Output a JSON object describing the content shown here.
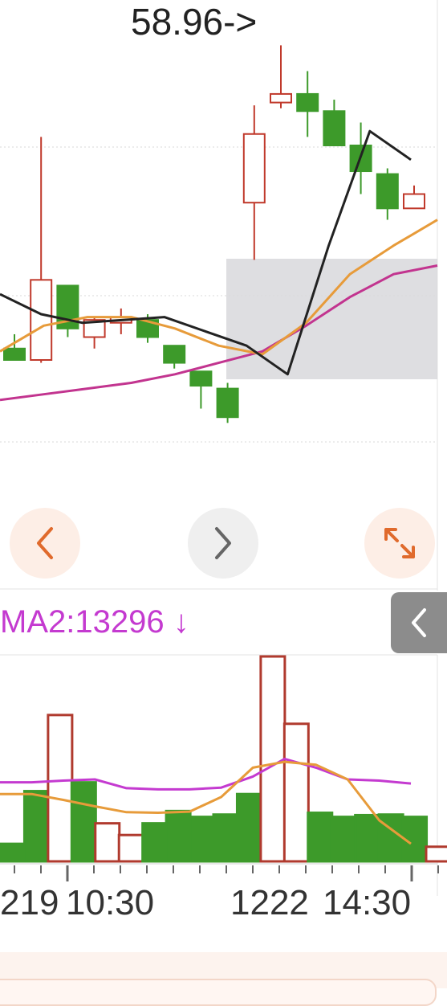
{
  "chart_data": [
    {
      "type": "candlestick",
      "title": "",
      "ylim": [
        45,
        60
      ],
      "annotation": "58.96->",
      "colors": {
        "up": "#c0392b",
        "down": "#3d9a2a",
        "ma_black": "#222222",
        "ma_orange": "#e79b3a",
        "ma_magenta": "#c2348f",
        "highlight": "#d8d8dc"
      },
      "candles": [
        {
          "open": 50.4,
          "close": 50.0,
          "high": 50.9,
          "low": 50.0
        },
        {
          "open": 50.0,
          "close": 52.8,
          "high": 57.8,
          "low": 49.9
        },
        {
          "open": 52.6,
          "close": 51.1,
          "high": 52.6,
          "low": 50.8
        },
        {
          "open": 50.8,
          "close": 51.4,
          "high": 51.5,
          "low": 50.4
        },
        {
          "open": 51.3,
          "close": 51.5,
          "high": 51.8,
          "low": 50.9
        },
        {
          "open": 51.4,
          "close": 50.8,
          "high": 51.6,
          "low": 50.6
        },
        {
          "open": 50.5,
          "close": 49.9,
          "high": 50.5,
          "low": 49.7
        },
        {
          "open": 49.6,
          "close": 49.1,
          "high": 49.6,
          "low": 48.3
        },
        {
          "open": 49.0,
          "close": 48.0,
          "high": 49.2,
          "low": 47.8
        },
        {
          "open": 55.5,
          "close": 57.9,
          "high": 58.9,
          "low": 53.5
        },
        {
          "open": 59.0,
          "close": 59.3,
          "high": 61.0,
          "low": 58.8
        },
        {
          "open": 59.3,
          "close": 58.7,
          "high": 60.1,
          "low": 57.8
        },
        {
          "open": 58.7,
          "close": 57.5,
          "high": 59.1,
          "low": 57.5
        },
        {
          "open": 57.5,
          "close": 56.6,
          "high": 58.3,
          "low": 55.8
        },
        {
          "open": 56.5,
          "close": 55.3,
          "high": 56.7,
          "low": 54.9
        },
        {
          "open": 55.3,
          "close": 55.8,
          "high": 56.1,
          "low": 55.3
        }
      ],
      "ma_black": [
        52.3,
        51.6,
        51.3,
        51.4,
        51.5,
        51.0,
        50.5,
        49.5,
        54.0,
        58.0,
        57.0
      ],
      "ma_orange": [
        50.3,
        51.2,
        51.5,
        51.5,
        51.1,
        50.5,
        50.2,
        51.3,
        53.0,
        54.0,
        54.9
      ],
      "ma_magenta": [
        48.6,
        48.8,
        49.0,
        49.2,
        49.5,
        49.9,
        50.3,
        51.2,
        52.2,
        53.0,
        53.3
      ]
    },
    {
      "type": "bar",
      "title": "MA2:13296 ↓",
      "x_ticks": [
        "219",
        "10:30",
        "1222",
        "14:30"
      ],
      "ylim": [
        0,
        35000
      ],
      "values": [
        3000,
        12000,
        25000,
        13500,
        6500,
        4500,
        6500,
        8600,
        7600,
        8000,
        11500,
        38000,
        23500,
        8300,
        7600,
        7900,
        8000,
        7600,
        2500
      ],
      "up": [
        false,
        false,
        true,
        false,
        true,
        true,
        false,
        false,
        false,
        false,
        false,
        true,
        true,
        false,
        false,
        false,
        false,
        false,
        true
      ],
      "ma_orange": [
        11500,
        11500,
        10500,
        9400,
        8400,
        8300,
        8500,
        11000,
        16000,
        17000,
        16500,
        14000,
        7000,
        3000
      ],
      "ma_magenta": [
        13500,
        13500,
        13800,
        14000,
        12500,
        12300,
        12300,
        12600,
        14500,
        17500,
        16000,
        14000,
        13800,
        13296
      ]
    }
  ],
  "labels": {
    "hi_annotation": "58.96->",
    "volume_ma": "MA2:13296 ↓",
    "ticks": [
      "219",
      "10:30",
      "1222",
      "14:30"
    ]
  },
  "controls": {
    "prev": "chevron-left-icon",
    "next": "chevron-right-icon",
    "expand": "expand-arrows-icon",
    "collapse": "chevron-left-icon"
  }
}
